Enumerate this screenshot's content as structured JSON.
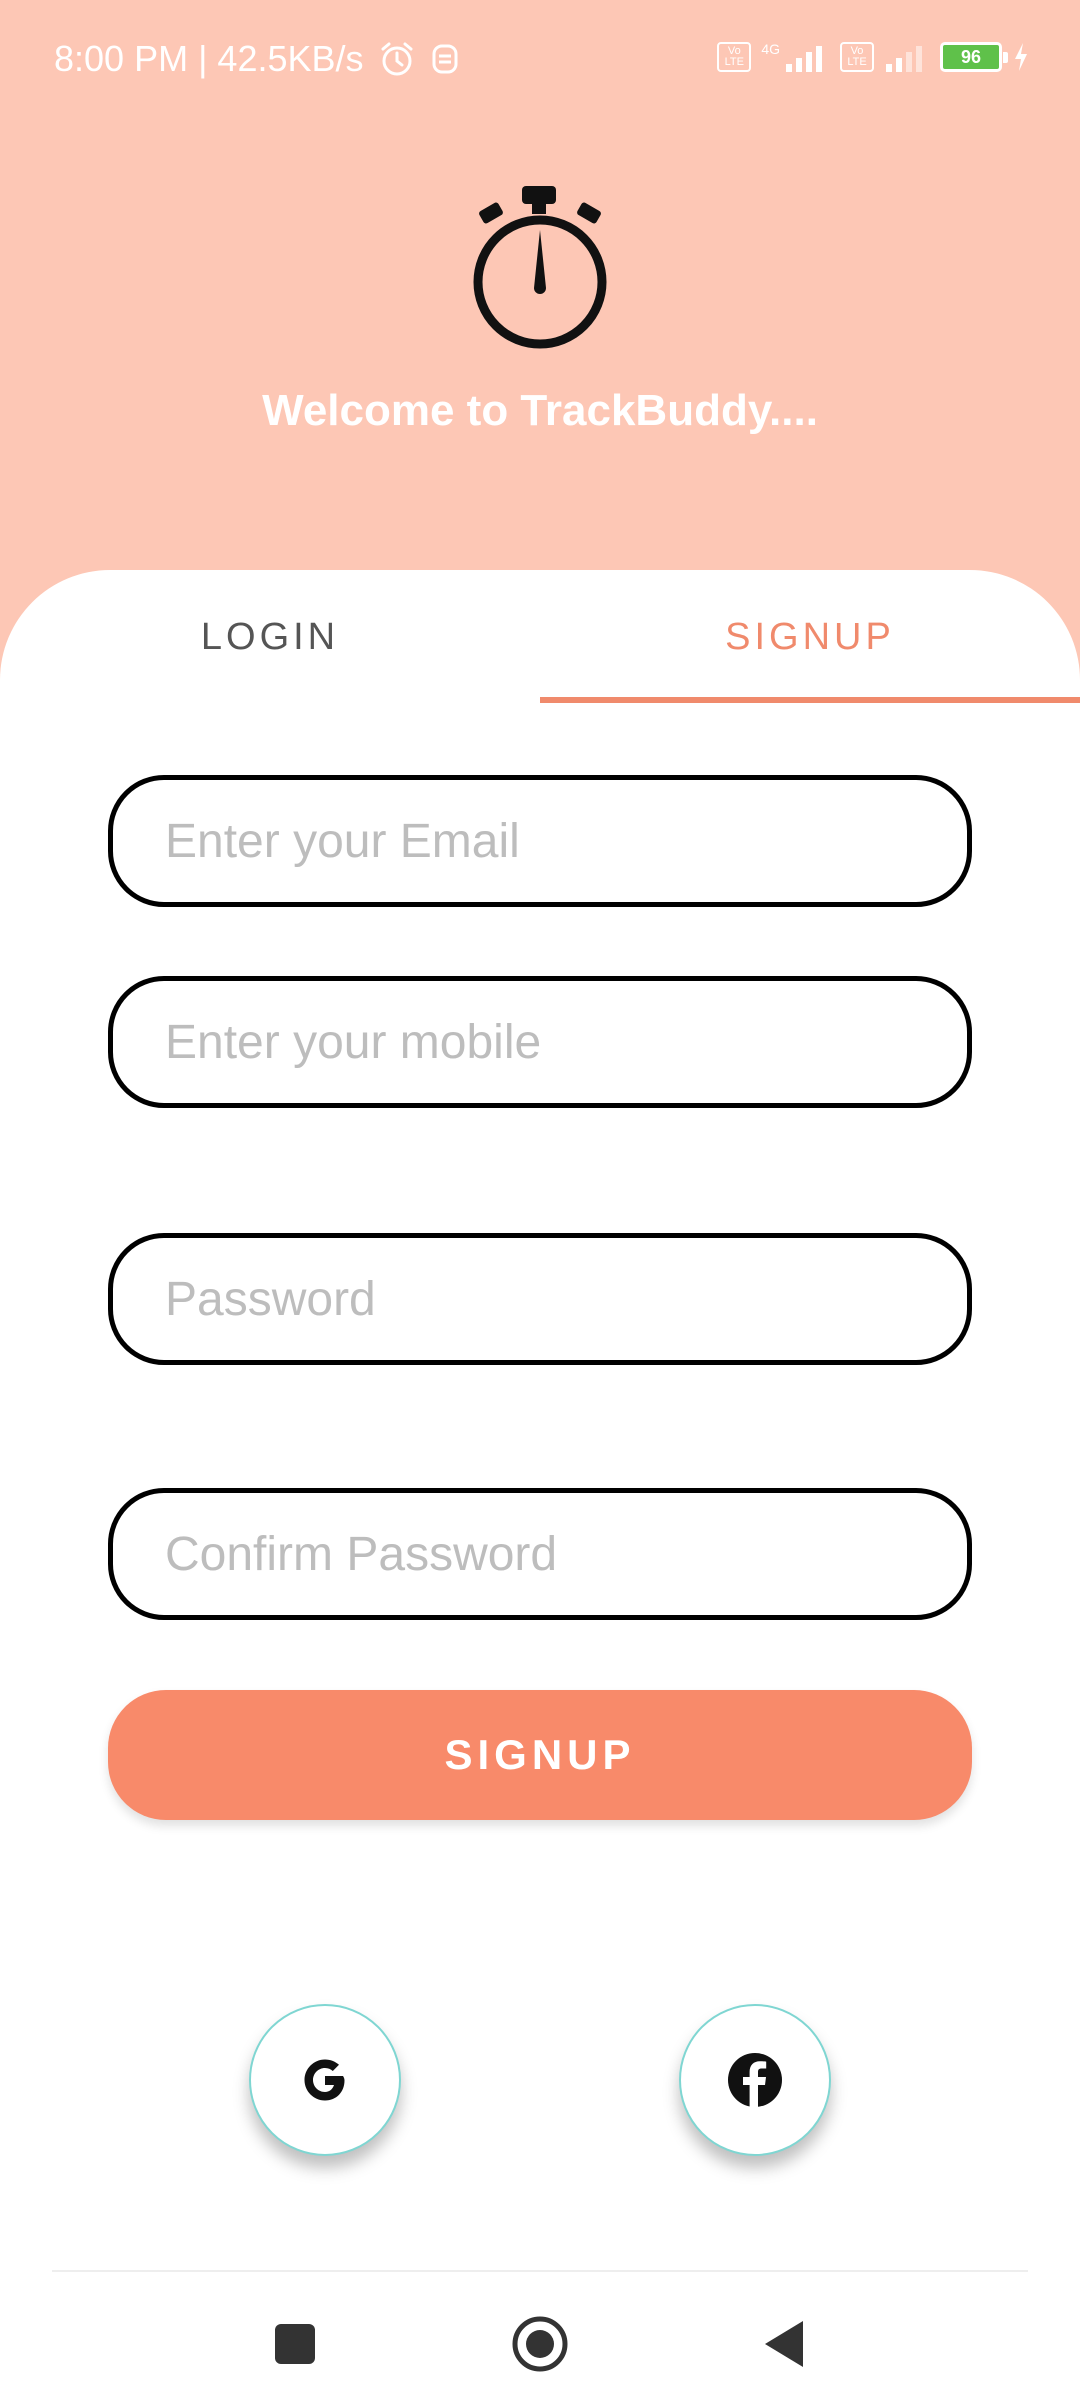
{
  "status_bar": {
    "time_speed": "8:00 PM | 42.5KB/s",
    "volte_1": "Vo LTE",
    "network_label": "4G",
    "volte_2": "Vo LTE",
    "battery_level": "96"
  },
  "header": {
    "logo_icon": "stopwatch-icon",
    "welcome_text": "Welcome to TrackBuddy...."
  },
  "tabs": {
    "login_label": "LOGIN",
    "signup_label": "SIGNUP",
    "active_tab": "SIGNUP"
  },
  "form": {
    "email_placeholder": "Enter your Email",
    "mobile_placeholder": "Enter your mobile",
    "password_placeholder": "Password",
    "confirm_password_placeholder": "Confirm Password",
    "submit_label": "SIGNUP"
  },
  "social": {
    "google_icon": "google-icon",
    "facebook_icon": "facebook-icon"
  },
  "colors": {
    "header_background": "#fdc7b5",
    "accent": "#f88a6a",
    "tab_active": "#f08a6c"
  }
}
